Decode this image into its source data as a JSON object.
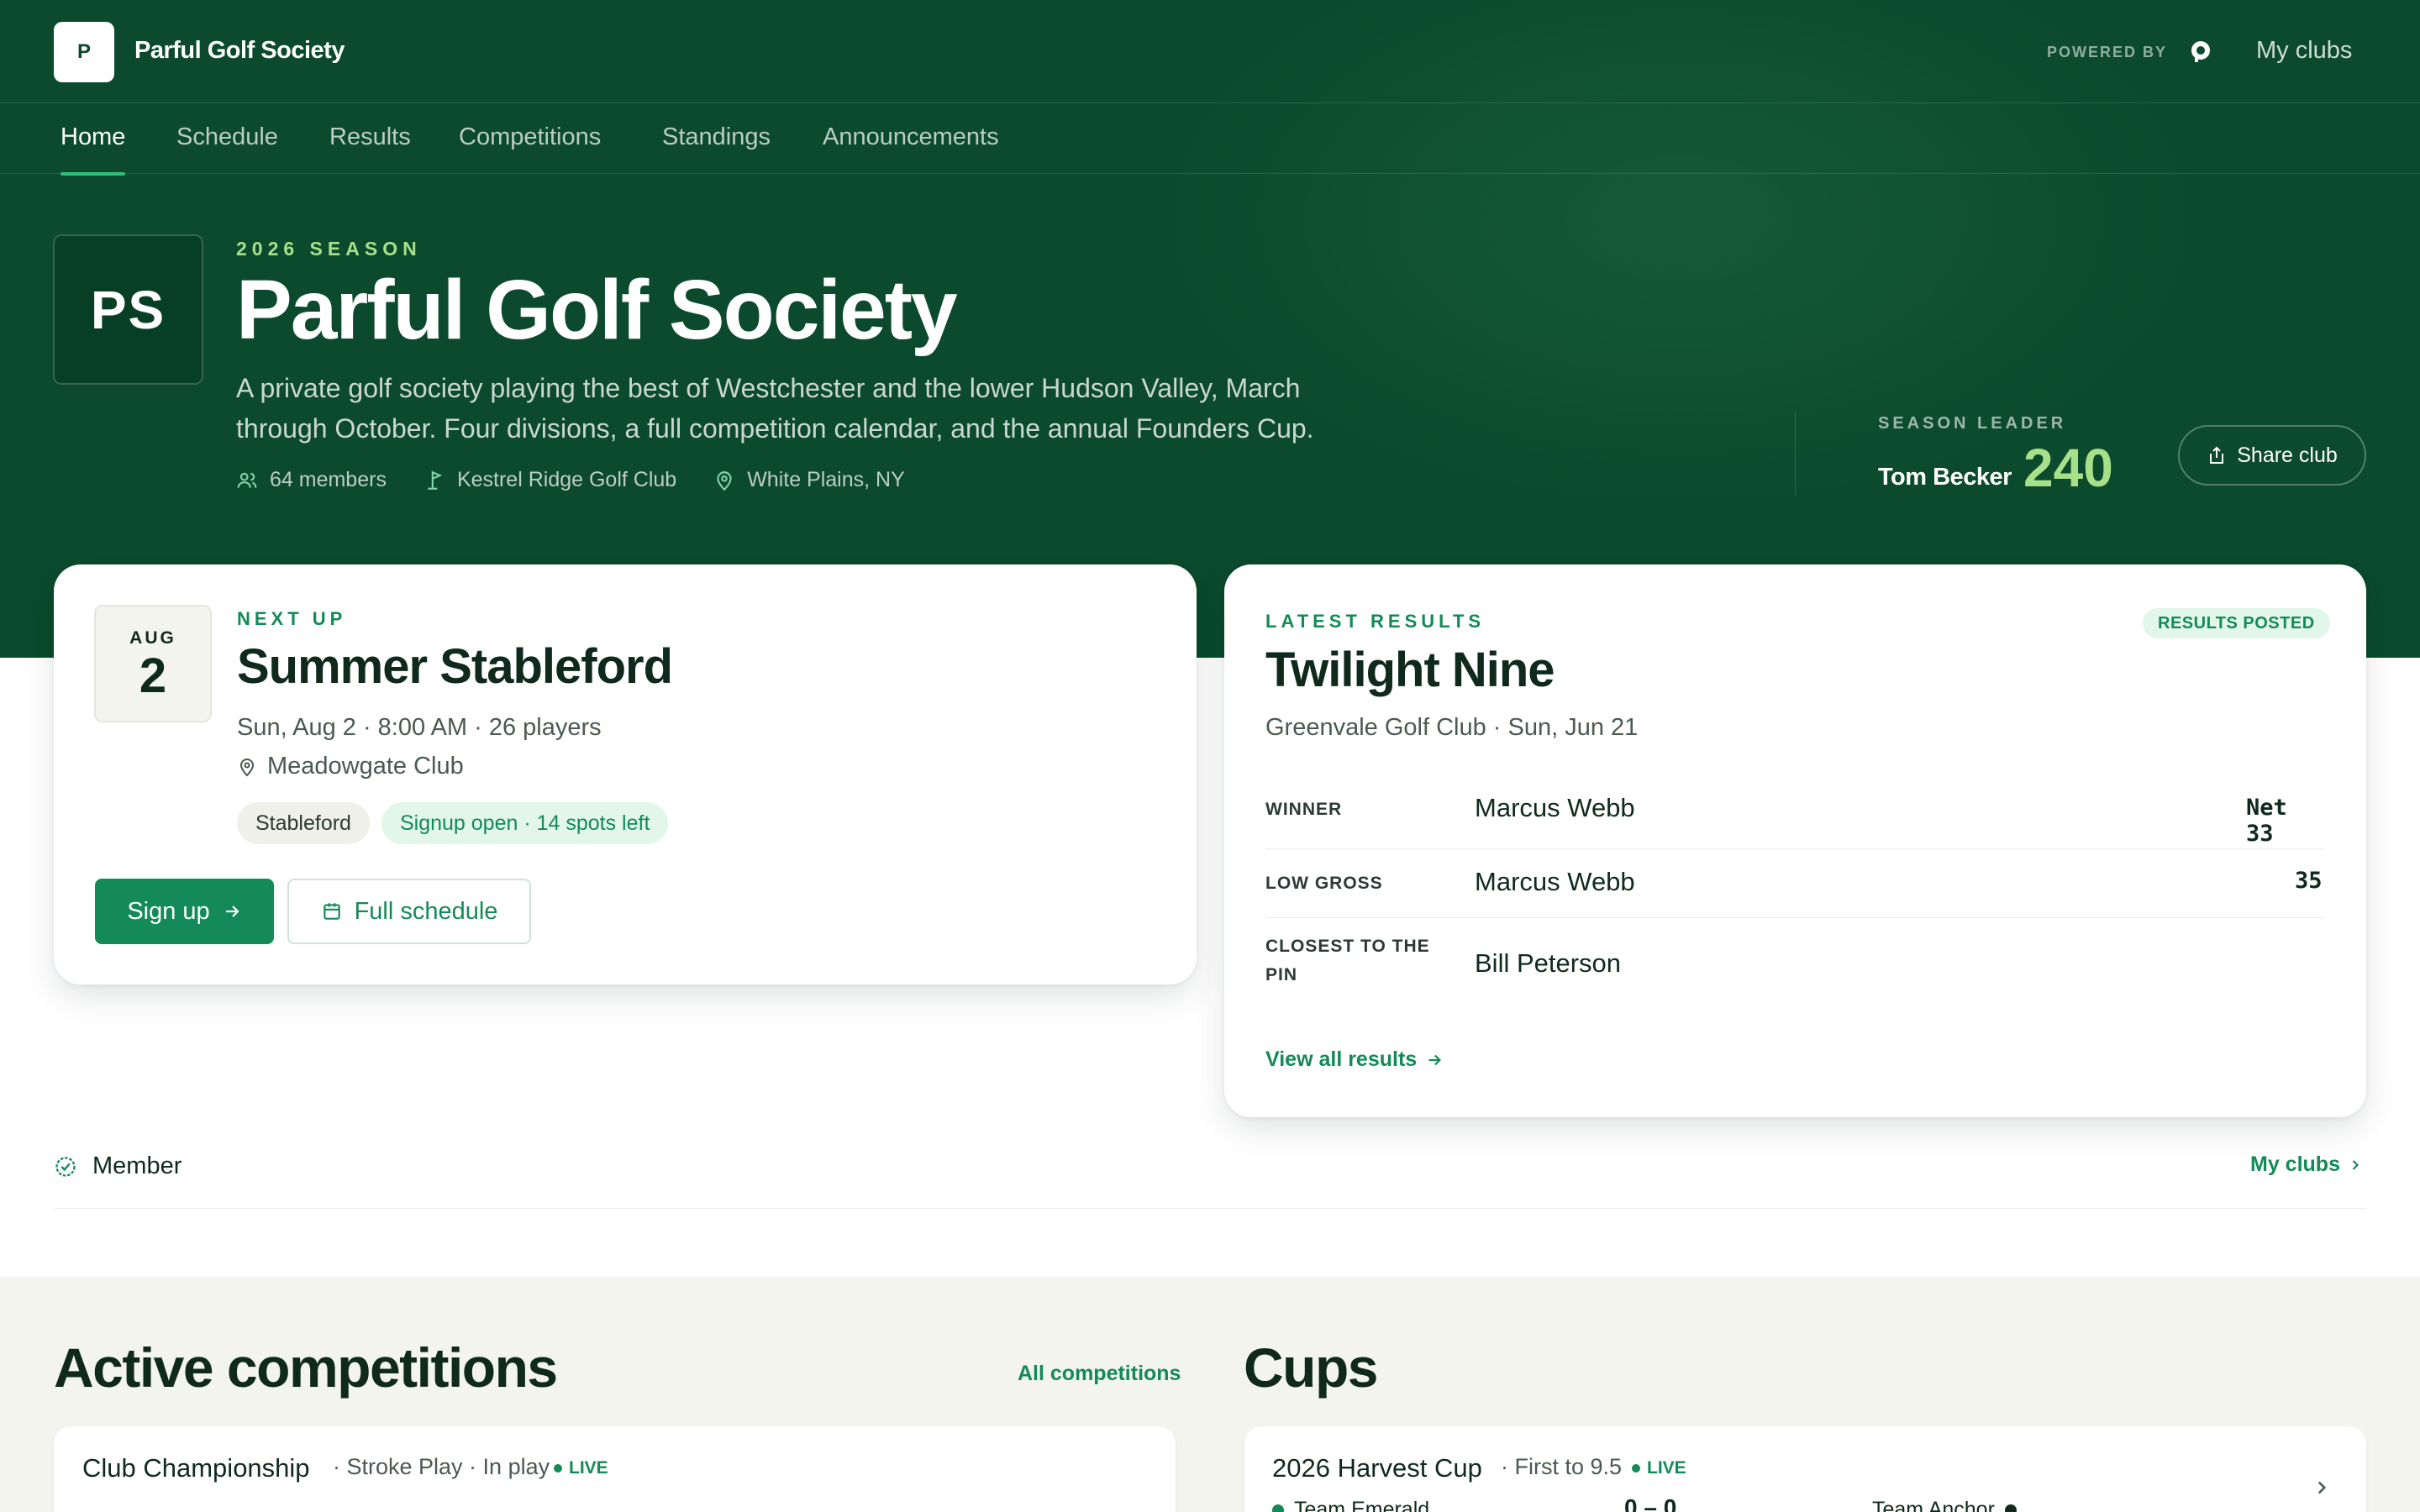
{
  "brand": {
    "logo_letter": "P",
    "name": "Parful Golf Society",
    "powered_by": "POWERED BY",
    "my_clubs": "My clubs"
  },
  "nav": [
    {
      "label": "Home",
      "active": true
    },
    {
      "label": "Schedule"
    },
    {
      "label": "Results"
    },
    {
      "label": "Competitions"
    },
    {
      "label": "Standings"
    },
    {
      "label": "Announcements"
    }
  ],
  "hero": {
    "badge": "PS",
    "season": "2026 SEASON",
    "title": "Parful Golf Society",
    "description": "A private golf society playing the best of Westchester and the lower Hudson Valley, March through October. Four divisions, a full competition calendar, and the annual Founders Cup.",
    "members": "64 members",
    "home_club": "Kestrel Ridge Golf Club",
    "location": "White Plains, NY",
    "leader_label": "SEASON LEADER",
    "leader_name": "Tom Becker",
    "leader_points": "240",
    "share": "Share club"
  },
  "next_up": {
    "eyebrow": "NEXT UP",
    "month": "AUG",
    "day": "2",
    "title": "Summer Stableford",
    "when": "Sun, Aug 2 · 8:00 AM · 26 players",
    "venue": "Meadowgate Club",
    "tags": [
      "Stableford",
      "Signup open · 14 spots left"
    ],
    "signup": "Sign up",
    "full_schedule": "Full schedule"
  },
  "latest": {
    "eyebrow": "LATEST RESULTS",
    "badge": "RESULTS POSTED",
    "title": "Twilight Nine",
    "sub": "Greenvale Golf Club · Sun, Jun 21",
    "rows": [
      {
        "label": "WINNER",
        "name": "Marcus Webb",
        "score": "Net 33"
      },
      {
        "label": "LOW GROSS",
        "name": "Marcus Webb",
        "score": "35"
      },
      {
        "label": "CLOSEST TO THE PIN",
        "name": "Bill Peterson",
        "score": ""
      }
    ],
    "view_all": "View all results"
  },
  "membership": {
    "status": "Member",
    "my_clubs": "My clubs"
  },
  "competitions": {
    "title": "Active competitions",
    "all_link": "All competitions",
    "items": [
      {
        "name": "Club Championship",
        "meta": "· Stroke Play · In play",
        "live": "LIVE"
      }
    ]
  },
  "cups": {
    "title": "Cups",
    "items": [
      {
        "name": "2026 Harvest Cup",
        "meta": "· First to 9.5",
        "live": "LIVE",
        "team_a": "Team Emerald",
        "team_b": "Team Anchor",
        "score": "0 – 0"
      }
    ]
  },
  "colors": {
    "brand_green": "#0b4a2c",
    "accent": "#138a57",
    "lime": "#a8e08a"
  }
}
